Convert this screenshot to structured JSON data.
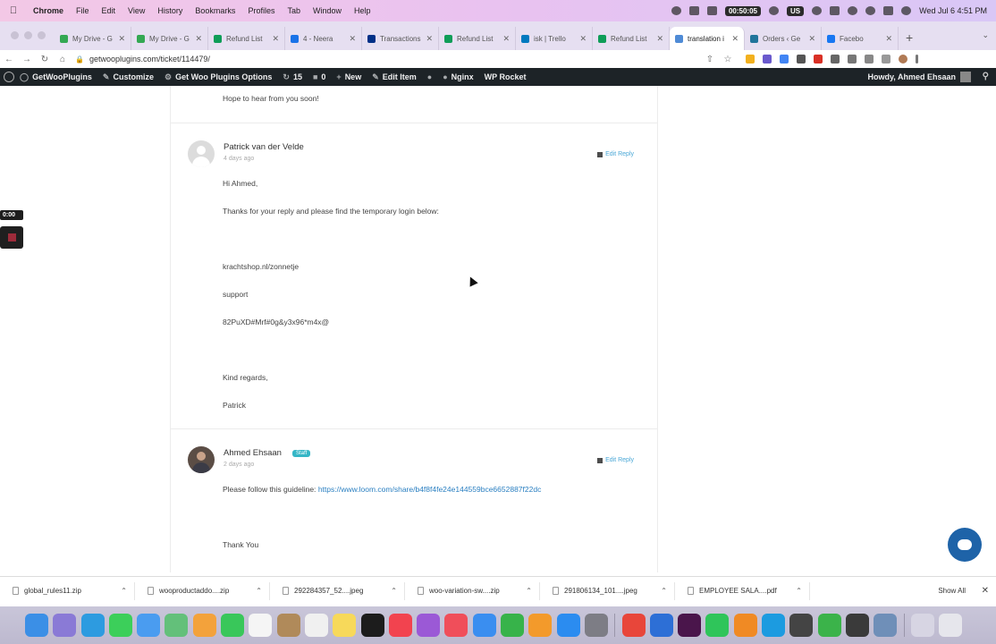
{
  "menubar": {
    "items": [
      {
        "label": "Chrome",
        "bold": true
      },
      {
        "label": "File"
      },
      {
        "label": "Edit"
      },
      {
        "label": "View"
      },
      {
        "label": "History"
      },
      {
        "label": "Bookmarks"
      },
      {
        "label": "Profiles"
      },
      {
        "label": "Tab"
      },
      {
        "label": "Window"
      },
      {
        "label": "Help"
      }
    ],
    "recording_time": "00:50:05",
    "keyboard_layout": "US",
    "clock": "Wed Jul 6  4:51 PM"
  },
  "tabs": [
    {
      "label": "My Drive - G",
      "fav": "#34a853"
    },
    {
      "label": "My Drive - G",
      "fav": "#34a853"
    },
    {
      "label": "Refund List",
      "fav": "#0f9d58"
    },
    {
      "label": "4 - Neera",
      "fav": "#1a73e8"
    },
    {
      "label": "Transactions",
      "fav": "#003087"
    },
    {
      "label": "Refund List",
      "fav": "#0f9d58"
    },
    {
      "label": "isk | Trello",
      "fav": "#0079bf"
    },
    {
      "label": "Refund List",
      "fav": "#0f9d58"
    },
    {
      "label": "translation i",
      "fav": "#4f8bd6",
      "active": true
    },
    {
      "label": "Orders ‹ Ge",
      "fav": "#21759b"
    },
    {
      "label": "Facebo",
      "fav": "#1877f2"
    }
  ],
  "address": {
    "url": "getwooplugins.com/ticket/114479/"
  },
  "wpbar": {
    "site": "GetWooPlugins",
    "customize": "Customize",
    "options": "Get Woo Plugins Options",
    "updates": "15",
    "comments": "0",
    "new": "New",
    "edit_item": "Edit Item",
    "nginx": "Nginx",
    "rocket": "WP Rocket",
    "howdy": "Howdy, Ahmed Ehsaan"
  },
  "thread": {
    "prev_tail": "Hope to hear from you soon!",
    "reply1": {
      "author": "Patrick van der Velde",
      "ago": "4 days ago",
      "edit": "Edit Reply",
      "lines": [
        "Hi Ahmed,",
        "Thanks for your reply and please find the temporary login below:",
        "krachtshop.nl/zonnetje",
        "support",
        "82PuXD#Mrf#0g&y3x96*m4x@",
        "Kind regards,",
        "Patrick"
      ]
    },
    "reply2": {
      "author": "Ahmed Ehsaan",
      "badge": "Staff",
      "ago": "2 days ago",
      "edit": "Edit Reply",
      "guideline_text": "Please follow this guideline:",
      "link": "https://www.loom.com/share/b4f8f4fe24e144559bce6652887f22dc",
      "thanks": "Thank You"
    }
  },
  "recorder": {
    "time": "0:00"
  },
  "downloads": {
    "items": [
      {
        "name": "global_rules11.zip"
      },
      {
        "name": "wooproductaddo....zip"
      },
      {
        "name": "292284357_52....jpeg"
      },
      {
        "name": "woo-variation-sw....zip"
      },
      {
        "name": "291806134_101....jpeg"
      },
      {
        "name": "EMPLOYEE SALA....pdf"
      }
    ],
    "show_all": "Show All"
  },
  "dock": {
    "apps": [
      {
        "name": "finder",
        "color": "#3b8fe6"
      },
      {
        "name": "launchpad",
        "color": "#8a7ad6"
      },
      {
        "name": "safari",
        "color": "#2d9be0"
      },
      {
        "name": "messages",
        "color": "#3ccf5a"
      },
      {
        "name": "mail",
        "color": "#4a9cf0"
      },
      {
        "name": "maps",
        "color": "#63c07a"
      },
      {
        "name": "photos",
        "color": "#f3a23b"
      },
      {
        "name": "facetime",
        "color": "#39c75a"
      },
      {
        "name": "calendar",
        "color": "#f5f5f5"
      },
      {
        "name": "contacts",
        "color": "#b08a5a"
      },
      {
        "name": "reminders",
        "color": "#f0f0f0"
      },
      {
        "name": "notes",
        "color": "#f7d95a"
      },
      {
        "name": "tv",
        "color": "#1c1c1c"
      },
      {
        "name": "music",
        "color": "#f2434f"
      },
      {
        "name": "podcasts",
        "color": "#9b59d6"
      },
      {
        "name": "news",
        "color": "#f04e5a"
      },
      {
        "name": "keynote",
        "color": "#3a8ef0"
      },
      {
        "name": "numbers",
        "color": "#37b34a"
      },
      {
        "name": "pages",
        "color": "#f39a2b"
      },
      {
        "name": "app-store",
        "color": "#2b8cf0"
      },
      {
        "name": "system-preferences",
        "color": "#7d7d85"
      },
      {
        "name": "sep"
      },
      {
        "name": "chrome",
        "color": "#e8463a"
      },
      {
        "name": "screenrecorder",
        "color": "#2d6fd6"
      },
      {
        "name": "slack",
        "color": "#4a154b"
      },
      {
        "name": "whatsapp",
        "color": "#2fc55a"
      },
      {
        "name": "sublime",
        "color": "#f08a24"
      },
      {
        "name": "skype",
        "color": "#1c9be0"
      },
      {
        "name": "tableplus",
        "color": "#444444"
      },
      {
        "name": "terminal-green",
        "color": "#3bb34a"
      },
      {
        "name": "calculator",
        "color": "#3a3a3a"
      },
      {
        "name": "preview",
        "color": "#6f8fb8"
      },
      {
        "name": "sep"
      },
      {
        "name": "downloads-stack",
        "color": "#d7d5e3"
      },
      {
        "name": "trash",
        "color": "#e6e6ec"
      }
    ]
  }
}
